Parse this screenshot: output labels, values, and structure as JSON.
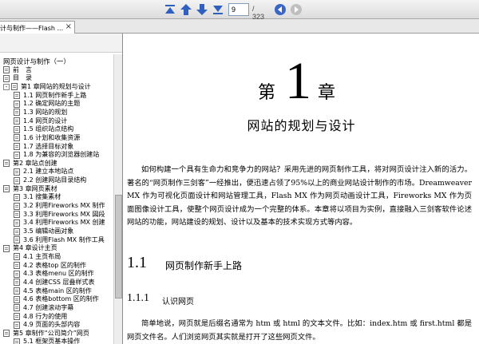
{
  "toolbar": {
    "first_page_icon": "first-page-icon",
    "prev_page_icon": "arrow-up-icon",
    "next_page_icon": "arrow-down-icon",
    "last_page_icon": "last-page-icon",
    "current_page": "9",
    "total_pages": "/ 323",
    "back_icon": "circle-left-icon",
    "forward_icon": "circle-right-icon",
    "colors": {
      "nav_icon": "#2f5fbf",
      "back_active": "#3a66c8",
      "forward_disabled": "#bfbfbf"
    }
  },
  "tab": {
    "title": "计与制作——Flash ...",
    "close_label": "×"
  },
  "bookmarks": [
    {
      "label": "网页设计与制作（一）",
      "level": 0,
      "icon": false
    },
    {
      "label": "前　言",
      "level": 1,
      "icon": true
    },
    {
      "label": "目　录",
      "level": 1,
      "icon": true
    },
    {
      "label": "第1 章网站的规划与设计",
      "level": 1,
      "icon": true,
      "expand": "-"
    },
    {
      "label": "1.1 网页制作新手上路",
      "level": 2,
      "icon": true
    },
    {
      "label": "1.2 确定网站的主题",
      "level": 2,
      "icon": true
    },
    {
      "label": "1.3 网站的规划",
      "level": 2,
      "icon": true
    },
    {
      "label": "1.4 网页的设计",
      "level": 2,
      "icon": true
    },
    {
      "label": "1.5 组织站点结构",
      "level": 2,
      "icon": true
    },
    {
      "label": "1.6 计划和收集资源",
      "level": 2,
      "icon": true
    },
    {
      "label": "1.7 选择目标对象",
      "level": 2,
      "icon": true
    },
    {
      "label": "1.8 为兼容的浏览器创建站",
      "level": 2,
      "icon": true
    },
    {
      "label": "第2 章站点创建",
      "level": 1,
      "icon": true
    },
    {
      "label": "2.1 建立本地站点",
      "level": 2,
      "icon": true
    },
    {
      "label": "2.2 创建网站目录结构",
      "level": 2,
      "icon": true
    },
    {
      "label": "第3 章网页素材",
      "level": 1,
      "icon": true
    },
    {
      "label": "3.1 搜集素材",
      "level": 2,
      "icon": true
    },
    {
      "label": "3.2 利用Fireworks MX 制作",
      "level": 2,
      "icon": true
    },
    {
      "label": "3.3 利用Fireworks MX 図段",
      "level": 2,
      "icon": true
    },
    {
      "label": "3.4 利用Fireworks MX 创建",
      "level": 2,
      "icon": true
    },
    {
      "label": "3.5 编辑动画对象",
      "level": 2,
      "icon": true
    },
    {
      "label": "3.6 利用Flash MX 制作工具",
      "level": 2,
      "icon": true
    },
    {
      "label": "第4 章设计主页",
      "level": 1,
      "icon": true
    },
    {
      "label": "4.1 主页布局",
      "level": 2,
      "icon": true
    },
    {
      "label": "4.2 表格top 区的制作",
      "level": 2,
      "icon": true
    },
    {
      "label": "4.3 表格menu 区的制作",
      "level": 2,
      "icon": true
    },
    {
      "label": "4.4 创建CSS 层叠样式表",
      "level": 2,
      "icon": true
    },
    {
      "label": "4.5 表格main 区的制作",
      "level": 2,
      "icon": true
    },
    {
      "label": "4.6 表格bottom 区的制作",
      "level": 2,
      "icon": true
    },
    {
      "label": "4.7 创建滚动字幕",
      "level": 2,
      "icon": true
    },
    {
      "label": "4.8 行为的使用",
      "level": 2,
      "icon": true
    },
    {
      "label": "4.9 页面的头部内容",
      "level": 2,
      "icon": true
    },
    {
      "label": "第5 章制作“公司简介”网页",
      "level": 1,
      "icon": true
    },
    {
      "label": "5.1 框架页基本操作",
      "level": 2,
      "icon": true
    }
  ],
  "page": {
    "chapter_prefix": "第",
    "chapter_number": "1",
    "chapter_suffix": "章",
    "chapter_title": "网站的规划与设计",
    "intro": "如何构建一个具有生命力和竞争力的网站？采用先进的网页制作工具，将对网页设计注入新的活力。著名的“网页制作三剑客”一经推出，便迅速占领了95%以上的商业网站设计制作的市场。Dreamweaver MX 作为可视化页面设计和网站管理工具，Flash MX 作为网页动画设计工具，Fireworks MX 作为页面图像设计工具，使整个网页设计成为一个完整的体系。本章将以项目为实例，直接融入三剑客软件论述网站的功能，网站建设的规划、设计以及基本的技术实现方式等内容。",
    "section_number": "1.1",
    "section_title": "网页制作新手上路",
    "subsection_number": "1.1.1",
    "subsection_title": "认识网页",
    "body": "简单地说，网页就是后缀名通常为 htm 或 html 的文本文件。比如：index.htm 或 first.html 都是网页文件名。人们浏览网页其实就是打开了这些网页文件。"
  }
}
